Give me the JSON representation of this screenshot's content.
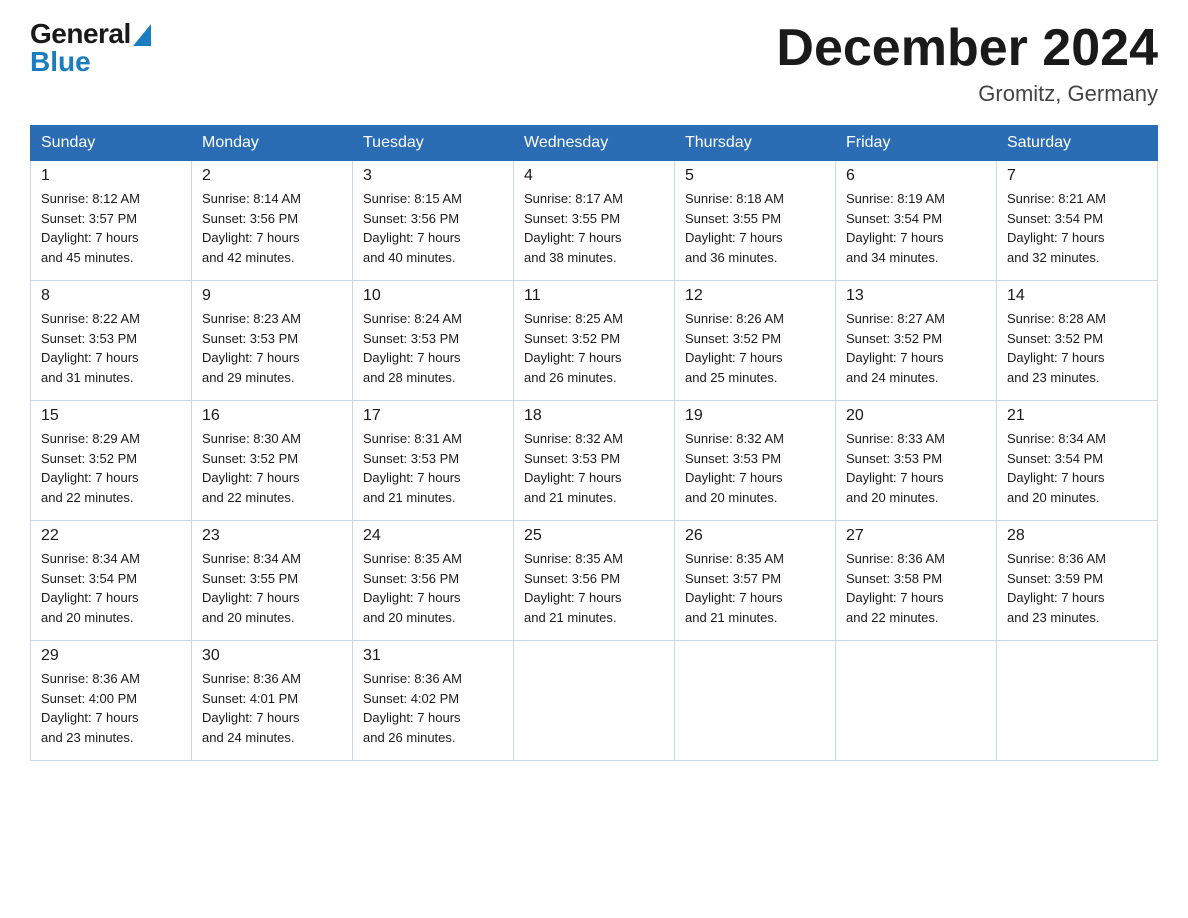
{
  "logo": {
    "general": "General",
    "blue": "Blue"
  },
  "title": {
    "month_year": "December 2024",
    "location": "Gromitz, Germany"
  },
  "days_of_week": [
    "Sunday",
    "Monday",
    "Tuesday",
    "Wednesday",
    "Thursday",
    "Friday",
    "Saturday"
  ],
  "weeks": [
    [
      {
        "day": "1",
        "sunrise": "8:12 AM",
        "sunset": "3:57 PM",
        "daylight": "7 hours and 45 minutes."
      },
      {
        "day": "2",
        "sunrise": "8:14 AM",
        "sunset": "3:56 PM",
        "daylight": "7 hours and 42 minutes."
      },
      {
        "day": "3",
        "sunrise": "8:15 AM",
        "sunset": "3:56 PM",
        "daylight": "7 hours and 40 minutes."
      },
      {
        "day": "4",
        "sunrise": "8:17 AM",
        "sunset": "3:55 PM",
        "daylight": "7 hours and 38 minutes."
      },
      {
        "day": "5",
        "sunrise": "8:18 AM",
        "sunset": "3:55 PM",
        "daylight": "7 hours and 36 minutes."
      },
      {
        "day": "6",
        "sunrise": "8:19 AM",
        "sunset": "3:54 PM",
        "daylight": "7 hours and 34 minutes."
      },
      {
        "day": "7",
        "sunrise": "8:21 AM",
        "sunset": "3:54 PM",
        "daylight": "7 hours and 32 minutes."
      }
    ],
    [
      {
        "day": "8",
        "sunrise": "8:22 AM",
        "sunset": "3:53 PM",
        "daylight": "7 hours and 31 minutes."
      },
      {
        "day": "9",
        "sunrise": "8:23 AM",
        "sunset": "3:53 PM",
        "daylight": "7 hours and 29 minutes."
      },
      {
        "day": "10",
        "sunrise": "8:24 AM",
        "sunset": "3:53 PM",
        "daylight": "7 hours and 28 minutes."
      },
      {
        "day": "11",
        "sunrise": "8:25 AM",
        "sunset": "3:52 PM",
        "daylight": "7 hours and 26 minutes."
      },
      {
        "day": "12",
        "sunrise": "8:26 AM",
        "sunset": "3:52 PM",
        "daylight": "7 hours and 25 minutes."
      },
      {
        "day": "13",
        "sunrise": "8:27 AM",
        "sunset": "3:52 PM",
        "daylight": "7 hours and 24 minutes."
      },
      {
        "day": "14",
        "sunrise": "8:28 AM",
        "sunset": "3:52 PM",
        "daylight": "7 hours and 23 minutes."
      }
    ],
    [
      {
        "day": "15",
        "sunrise": "8:29 AM",
        "sunset": "3:52 PM",
        "daylight": "7 hours and 22 minutes."
      },
      {
        "day": "16",
        "sunrise": "8:30 AM",
        "sunset": "3:52 PM",
        "daylight": "7 hours and 22 minutes."
      },
      {
        "day": "17",
        "sunrise": "8:31 AM",
        "sunset": "3:53 PM",
        "daylight": "7 hours and 21 minutes."
      },
      {
        "day": "18",
        "sunrise": "8:32 AM",
        "sunset": "3:53 PM",
        "daylight": "7 hours and 21 minutes."
      },
      {
        "day": "19",
        "sunrise": "8:32 AM",
        "sunset": "3:53 PM",
        "daylight": "7 hours and 20 minutes."
      },
      {
        "day": "20",
        "sunrise": "8:33 AM",
        "sunset": "3:53 PM",
        "daylight": "7 hours and 20 minutes."
      },
      {
        "day": "21",
        "sunrise": "8:34 AM",
        "sunset": "3:54 PM",
        "daylight": "7 hours and 20 minutes."
      }
    ],
    [
      {
        "day": "22",
        "sunrise": "8:34 AM",
        "sunset": "3:54 PM",
        "daylight": "7 hours and 20 minutes."
      },
      {
        "day": "23",
        "sunrise": "8:34 AM",
        "sunset": "3:55 PM",
        "daylight": "7 hours and 20 minutes."
      },
      {
        "day": "24",
        "sunrise": "8:35 AM",
        "sunset": "3:56 PM",
        "daylight": "7 hours and 20 minutes."
      },
      {
        "day": "25",
        "sunrise": "8:35 AM",
        "sunset": "3:56 PM",
        "daylight": "7 hours and 21 minutes."
      },
      {
        "day": "26",
        "sunrise": "8:35 AM",
        "sunset": "3:57 PM",
        "daylight": "7 hours and 21 minutes."
      },
      {
        "day": "27",
        "sunrise": "8:36 AM",
        "sunset": "3:58 PM",
        "daylight": "7 hours and 22 minutes."
      },
      {
        "day": "28",
        "sunrise": "8:36 AM",
        "sunset": "3:59 PM",
        "daylight": "7 hours and 23 minutes."
      }
    ],
    [
      {
        "day": "29",
        "sunrise": "8:36 AM",
        "sunset": "4:00 PM",
        "daylight": "7 hours and 23 minutes."
      },
      {
        "day": "30",
        "sunrise": "8:36 AM",
        "sunset": "4:01 PM",
        "daylight": "7 hours and 24 minutes."
      },
      {
        "day": "31",
        "sunrise": "8:36 AM",
        "sunset": "4:02 PM",
        "daylight": "7 hours and 26 minutes."
      },
      null,
      null,
      null,
      null
    ]
  ],
  "labels": {
    "sunrise": "Sunrise:",
    "sunset": "Sunset:",
    "daylight": "Daylight:"
  }
}
